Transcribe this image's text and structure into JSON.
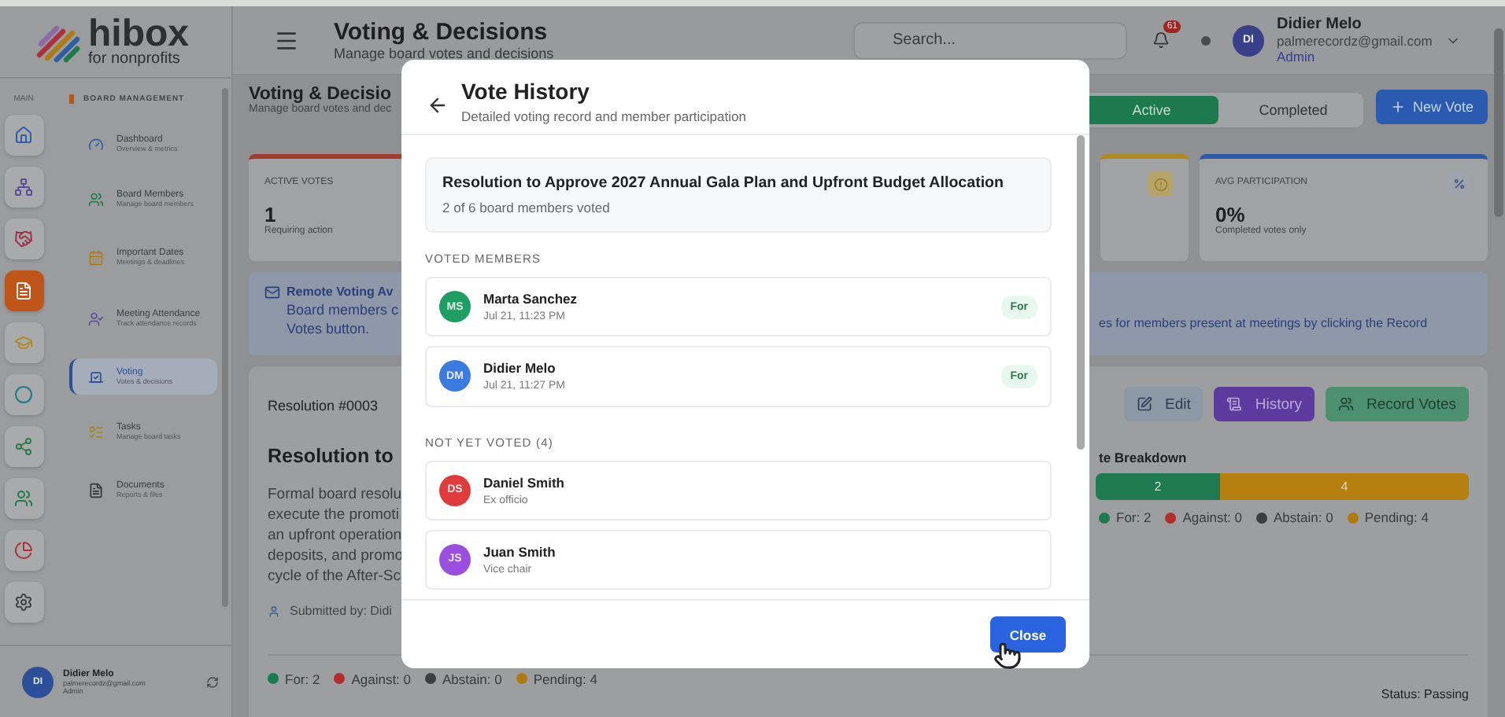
{
  "sidebar": {
    "logo": {
      "name": "hibox",
      "tagline": "for nonprofits"
    },
    "rail_label": "MAIN",
    "rail_items": [
      {
        "selected": false,
        "color": "#2d5fa8"
      },
      {
        "selected": false,
        "color": "#5e4a9a"
      },
      {
        "selected": false,
        "color": "#a0304a"
      },
      {
        "selected": true,
        "color": "#c0551a"
      },
      {
        "selected": false,
        "color": "#b08a1e"
      },
      {
        "selected": false,
        "color": "#1a7a8a"
      },
      {
        "selected": false,
        "color": "#2a7a4a"
      },
      {
        "selected": false,
        "color": "#1f7a4a"
      },
      {
        "selected": false,
        "color": "#b0303a"
      },
      {
        "selected": false,
        "color": "#404040"
      }
    ],
    "section": "BOARD MANAGEMENT",
    "nav_items": [
      {
        "title": "Dashboard",
        "subtitle": "Overview & metrics",
        "selected": false
      },
      {
        "title": "Board Members",
        "subtitle": "Manage board members",
        "selected": false
      },
      {
        "title": "Important Dates",
        "subtitle": "Meetings & deadlines",
        "selected": false
      },
      {
        "title": "Meeting Attendance",
        "subtitle": "Track attendance records",
        "selected": false
      },
      {
        "title": "Voting",
        "subtitle": "Votes & decisions",
        "selected": true
      },
      {
        "title": "Tasks",
        "subtitle": "Manage board tasks",
        "selected": false
      },
      {
        "title": "Documents",
        "subtitle": "Reports & files",
        "selected": false
      }
    ],
    "user": {
      "initials": "DI",
      "name": "Didier Melo",
      "email": "palmerecordz@gmail.com",
      "role": "Admin"
    }
  },
  "header": {
    "title": "Voting & Decisions",
    "subtitle": "Manage board votes and decisions",
    "search": {
      "placeholder": "Search..."
    },
    "notification_count": "61",
    "user": {
      "initials": "DI",
      "name": "Didier Melo",
      "email": "palmerecordz@gmail.com",
      "role": "Admin"
    }
  },
  "page": {
    "title": "Voting & Decisio",
    "subtitle": "Manage board votes and dec",
    "tabs": [
      {
        "label": "Active",
        "selected": true
      },
      {
        "label": "Completed",
        "selected": false
      }
    ],
    "new_vote": "New Vote"
  },
  "stats": [
    {
      "label": "ACTIVE VOTES",
      "value": "1",
      "note": "Requiring action",
      "color": "#a33a2e"
    },
    {
      "color": "#b08a1e"
    },
    {
      "label": "AVG PARTICIPATION",
      "value": "0%",
      "note": "Completed votes only",
      "color": "#2a5aa8"
    }
  ],
  "banner": {
    "title": "Remote Voting Av",
    "text_left": [
      "Board members c",
      "Votes button."
    ],
    "text_right": "es for members present at meetings by clicking the Record"
  },
  "resolution": {
    "number": "Resolution #0003",
    "title": "Resolution to",
    "description": [
      "Formal board resolu",
      "execute the promoti",
      "an upfront operation",
      "deposits, and promo",
      "cycle of the After-Sc"
    ],
    "submitted": "Submitted by: Didi",
    "actions": [
      {
        "kind": "edit",
        "label": "Edit"
      },
      {
        "kind": "history",
        "label": "History"
      },
      {
        "kind": "record",
        "label": "Record Votes"
      }
    ],
    "breakdown_title": "te Breakdown",
    "bar": [
      {
        "value": "2",
        "level": 0.333,
        "color": "#1f7a50"
      },
      {
        "value": "4",
        "level": 0.667,
        "color": "#b5800f"
      }
    ],
    "legend_right": [
      {
        "label": "For: 2",
        "color": "#1d7a4e"
      },
      {
        "label": "Against: 0",
        "color": "#b22d2d"
      },
      {
        "label": "Abstain: 0",
        "color": "#3d3d3d"
      },
      {
        "label": "Pending: 4",
        "color": "#b07a10"
      }
    ],
    "legend_bottom": [
      {
        "label": "For: 2",
        "color": "#1d7a4e"
      },
      {
        "label": "Against: 0",
        "color": "#b22d2d"
      },
      {
        "label": "Abstain: 0",
        "color": "#3d3d3d"
      },
      {
        "label": "Pending: 4",
        "color": "#b07a10"
      }
    ],
    "status": "Status: Passing"
  },
  "modal": {
    "title": "Vote History",
    "subtitle": "Detailed voting record and member participation",
    "resolution_title": "Resolution to Approve 2027 Annual Gala Plan and Upfront Budget Allocation",
    "count": "2 of 6 board members voted",
    "voted_heading": "VOTED MEMBERS",
    "voted": [
      {
        "initials": "MS",
        "name": "Marta Sanchez",
        "time": "Jul 21, 11:23 PM",
        "vote": "For",
        "color": "#1e9e63"
      },
      {
        "initials": "DM",
        "name": "Didier Melo",
        "time": "Jul 21, 11:27 PM",
        "vote": "For",
        "color": "#3b7be0"
      }
    ],
    "pending_heading": "NOT YET VOTED (4)",
    "pending": [
      {
        "initials": "DS",
        "name": "Daniel Smith",
        "role": "Ex officio",
        "color": "#e03b3b"
      },
      {
        "initials": "JS",
        "name": "Juan Smith",
        "role": "Vice chair",
        "color": "#9b4fe0"
      }
    ],
    "close": "Close"
  }
}
